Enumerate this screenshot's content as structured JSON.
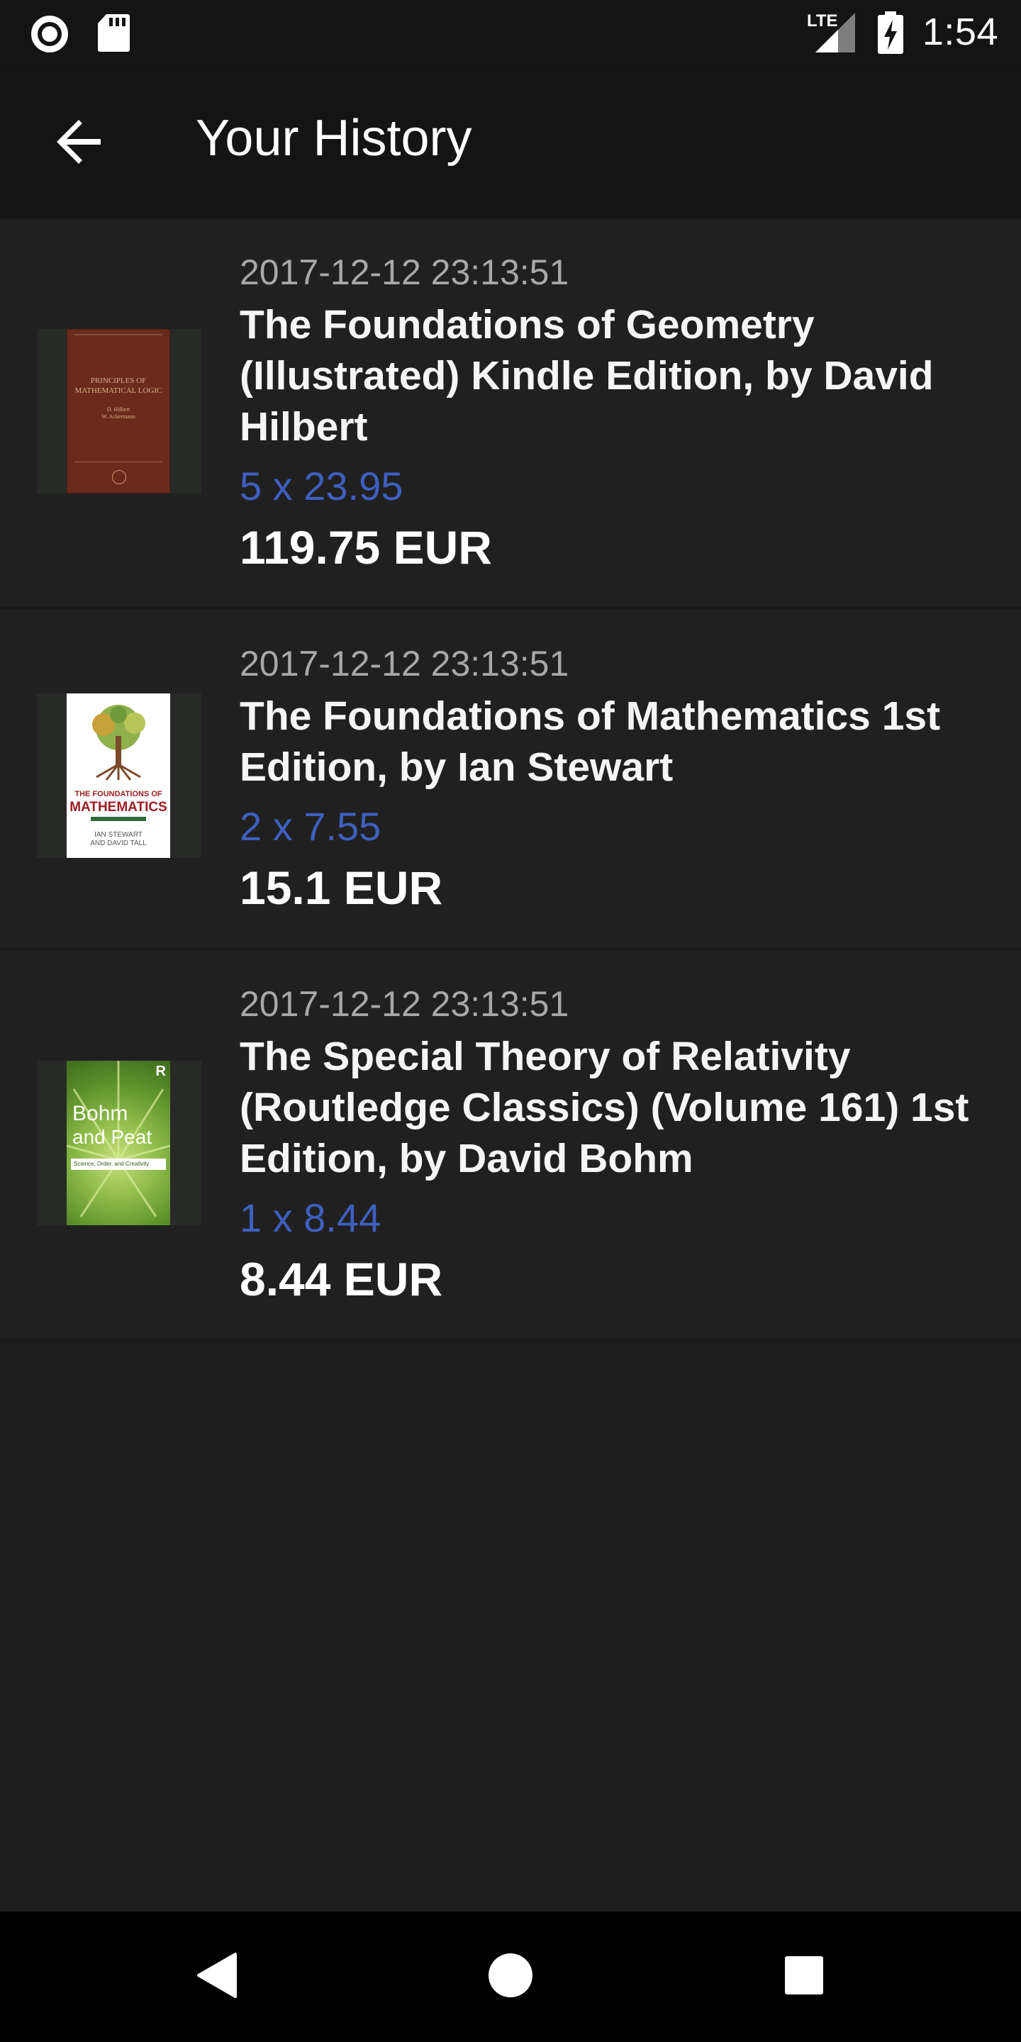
{
  "status_bar": {
    "network_label": "LTE",
    "time": "1:54"
  },
  "header": {
    "title": "Your History"
  },
  "history": [
    {
      "date": "2017-12-12 23:13:51",
      "title": "The Foundations of Geometry (Illustrated) Kindle Edition, by David Hilbert",
      "quantity": "5 x 23.95",
      "total": "119.75 EUR",
      "cover": {
        "line1": "Principles of",
        "line2": "Mathematical Logic",
        "authors1": "D. Hilbert",
        "authors2": "W. Ackermann",
        "color": "#6a2a1c"
      }
    },
    {
      "date": "2017-12-12 23:13:51",
      "title": "The Foundations of Mathematics 1st Edition, by Ian Stewart",
      "quantity": "2 x 7.55",
      "total": "15.1 EUR",
      "cover": {
        "line1": "THE FOUNDATIONS OF",
        "line2": "MATHEMATICS",
        "authors1": "IAN STEWART",
        "authors2": "AND DAVID TALL",
        "color": "#ffffff"
      }
    },
    {
      "date": "2017-12-12 23:13:51",
      "title": "The Special Theory of Relativity (Routledge Classics) (Volume 161) 1st Edition, by David Bohm",
      "quantity": "1 x 8.44",
      "total": "8.44 EUR",
      "cover": {
        "line1": "Bohm",
        "line2": "and Peat",
        "subtitle": "Science, Order, and Creativity",
        "badge": "R",
        "color": "#6fa436"
      }
    }
  ],
  "colors": {
    "background": "#1e1e1e",
    "item_background": "#202020",
    "app_bar": "#141414",
    "quantity_blue": "#3f5fbf",
    "date_gray": "#a8a8a8"
  }
}
